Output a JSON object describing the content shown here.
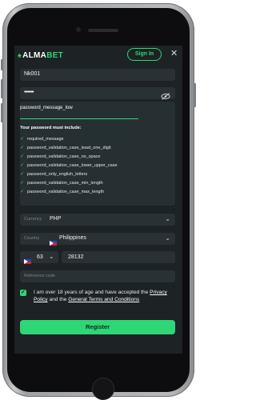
{
  "header": {
    "logo_prefix": "ALMA",
    "logo_suffix": "BET",
    "sign_in_label": "Sign In",
    "close_glyph": "✕"
  },
  "form": {
    "username_value": "Nk001",
    "password_value": "••••••••",
    "password_visibility_icon": "eye-slash-icon",
    "password_message": "password_message_low",
    "rules_title": "Your password must include:",
    "rules": [
      "required_message",
      "password_validation_case_least_one_digit",
      "password_validation_case_no_space",
      "password_validation_case_lower_upper_case",
      "password_only_english_letters",
      "password_validation_case_min_length",
      "password_validation_case_max_length"
    ],
    "currency_label": "Currency",
    "currency_value": "PHP",
    "country_label": "Country",
    "country_value": "Philippines",
    "phone_code": "63",
    "phone_number": "28132",
    "reference_placeholder": "Reference code",
    "terms_prefix": "I am over 18 years of age and have accepted the",
    "privacy_link": "Privacy Policy",
    "terms_and": "and the",
    "terms_link": "General Terms and Conditions",
    "register_label": "Register"
  },
  "colors": {
    "accent": "#2ed676",
    "background": "#1d2224",
    "field": "#2a3134"
  }
}
